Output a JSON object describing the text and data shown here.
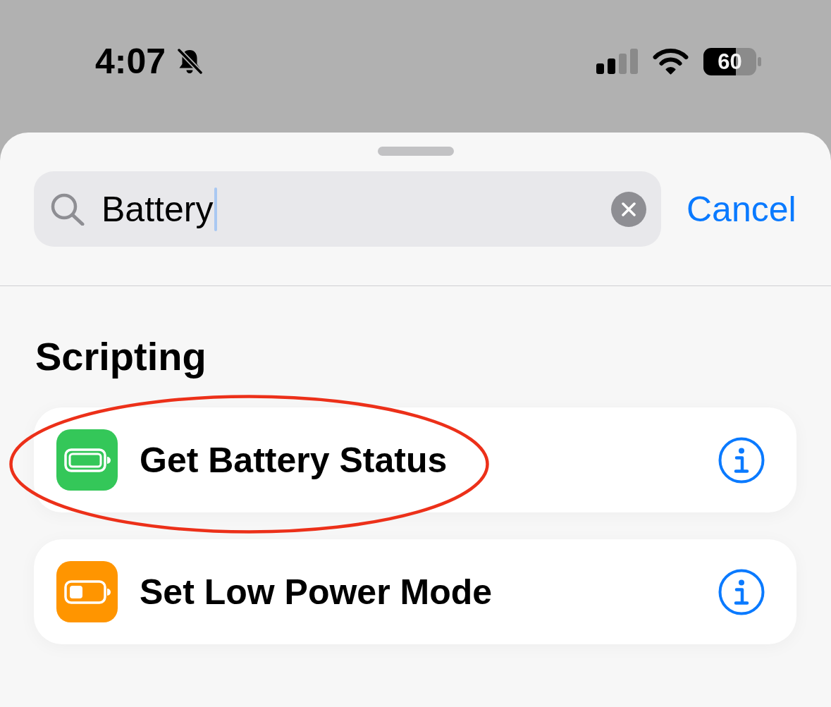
{
  "status_bar": {
    "time": "4:07",
    "silent": true,
    "battery_percent": "60"
  },
  "sheet": {
    "search": {
      "value": "Battery",
      "focused": true
    },
    "cancel": "Cancel",
    "sections": [
      {
        "title": "Scripting",
        "actions": [
          {
            "title": "Get Battery Status",
            "kind": "full",
            "color": "#34c759",
            "circled": true
          },
          {
            "title": "Set Low Power Mode",
            "kind": "low",
            "color": "#ff9500",
            "circled": false
          }
        ]
      }
    ]
  }
}
